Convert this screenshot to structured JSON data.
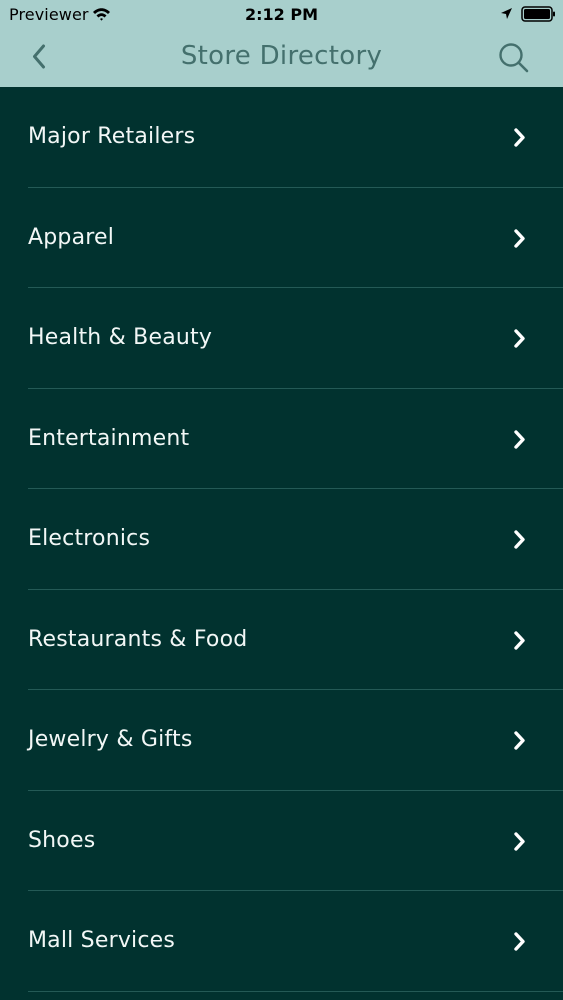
{
  "status_bar": {
    "carrier": "Previewer",
    "time": "2:12 PM",
    "icons": [
      "wifi-icon",
      "location-icon",
      "battery-icon"
    ]
  },
  "nav_bar": {
    "title": "Store Directory",
    "back_icon": "back-arrow-icon",
    "search_icon": "search-icon"
  },
  "categories": [
    {
      "label": "Major Retailers"
    },
    {
      "label": "Apparel"
    },
    {
      "label": "Health & Beauty"
    },
    {
      "label": "Entertainment"
    },
    {
      "label": "Electronics"
    },
    {
      "label": "Restaurants & Food"
    },
    {
      "label": "Jewelry & Gifts"
    },
    {
      "label": "Shoes"
    },
    {
      "label": "Mall Services"
    }
  ],
  "colors": {
    "header_background": "#a8cfcc",
    "header_title": "#44706d",
    "list_background": "#01322f",
    "list_text": "#f2f7f6",
    "divider": "#245a56"
  }
}
